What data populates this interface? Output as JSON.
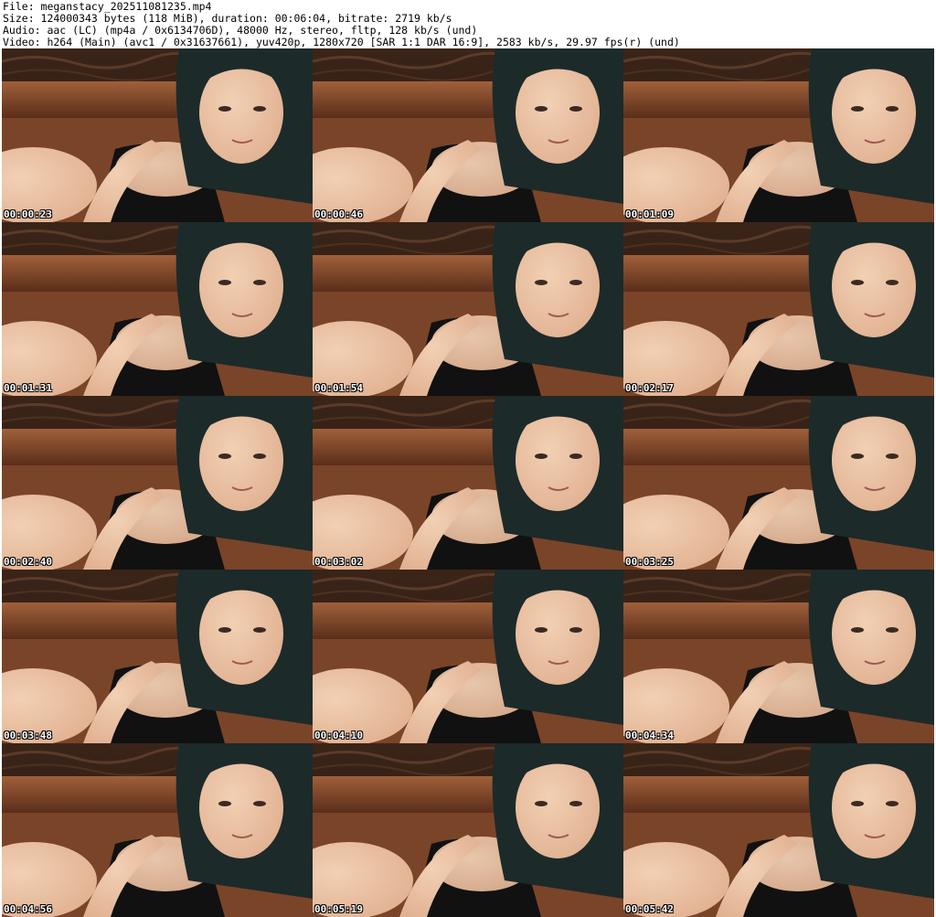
{
  "header": {
    "file": "File: meganstacy_202511081235.mp4",
    "size": "Size: 124000343 bytes (118 MiB), duration: 00:06:04, bitrate: 2719 kb/s",
    "audio": "Audio: aac (LC) (mp4a / 0x6134706D), 48000 Hz, stereo, fltp, 128 kb/s (und)",
    "video": "Video: h264 (Main) (avc1 / 0x31637661), yuv420p, 1280x720 [SAR 1:1 DAR 16:9], 2583 kb/s, 29.97 fps(r) (und)"
  },
  "thumbnails": [
    {
      "timestamp": "00:00:23"
    },
    {
      "timestamp": "00:00:46"
    },
    {
      "timestamp": "00:01:09"
    },
    {
      "timestamp": "00:01:31"
    },
    {
      "timestamp": "00:01:54"
    },
    {
      "timestamp": "00:02:17"
    },
    {
      "timestamp": "00:02:40"
    },
    {
      "timestamp": "00:03:02"
    },
    {
      "timestamp": "00:03:25"
    },
    {
      "timestamp": "00:03:48"
    },
    {
      "timestamp": "00:04:10"
    },
    {
      "timestamp": "00:04:34"
    },
    {
      "timestamp": "00:04:56"
    },
    {
      "timestamp": "00:05:19"
    },
    {
      "timestamp": "00:05:42"
    }
  ],
  "colors": {
    "background": "#ffffff",
    "text": "#000000",
    "timestamp": "#ffffff",
    "wall": "#2a1a12",
    "couch": "#8a4a2a",
    "skin": "#e0b090",
    "hair": "#1c2a2a",
    "top": "#111111"
  }
}
